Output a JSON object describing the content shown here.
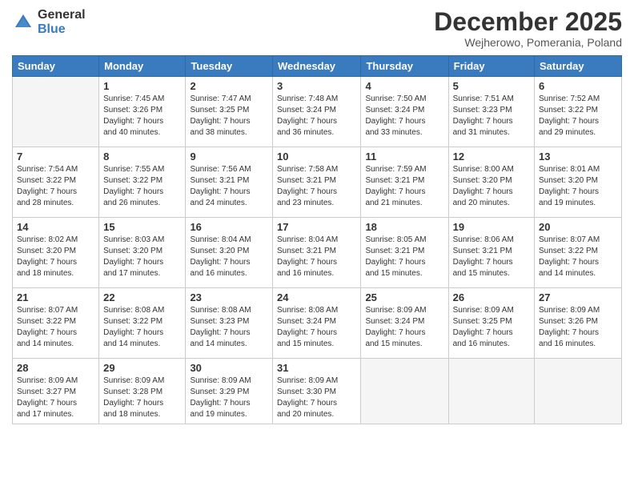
{
  "logo": {
    "general": "General",
    "blue": "Blue"
  },
  "title": "December 2025",
  "location": "Wejherowo, Pomerania, Poland",
  "days_of_week": [
    "Sunday",
    "Monday",
    "Tuesday",
    "Wednesday",
    "Thursday",
    "Friday",
    "Saturday"
  ],
  "weeks": [
    [
      {
        "day": "",
        "info": ""
      },
      {
        "day": "1",
        "info": "Sunrise: 7:45 AM\nSunset: 3:26 PM\nDaylight: 7 hours\nand 40 minutes."
      },
      {
        "day": "2",
        "info": "Sunrise: 7:47 AM\nSunset: 3:25 PM\nDaylight: 7 hours\nand 38 minutes."
      },
      {
        "day": "3",
        "info": "Sunrise: 7:48 AM\nSunset: 3:24 PM\nDaylight: 7 hours\nand 36 minutes."
      },
      {
        "day": "4",
        "info": "Sunrise: 7:50 AM\nSunset: 3:24 PM\nDaylight: 7 hours\nand 33 minutes."
      },
      {
        "day": "5",
        "info": "Sunrise: 7:51 AM\nSunset: 3:23 PM\nDaylight: 7 hours\nand 31 minutes."
      },
      {
        "day": "6",
        "info": "Sunrise: 7:52 AM\nSunset: 3:22 PM\nDaylight: 7 hours\nand 29 minutes."
      }
    ],
    [
      {
        "day": "7",
        "info": "Sunrise: 7:54 AM\nSunset: 3:22 PM\nDaylight: 7 hours\nand 28 minutes."
      },
      {
        "day": "8",
        "info": "Sunrise: 7:55 AM\nSunset: 3:22 PM\nDaylight: 7 hours\nand 26 minutes."
      },
      {
        "day": "9",
        "info": "Sunrise: 7:56 AM\nSunset: 3:21 PM\nDaylight: 7 hours\nand 24 minutes."
      },
      {
        "day": "10",
        "info": "Sunrise: 7:58 AM\nSunset: 3:21 PM\nDaylight: 7 hours\nand 23 minutes."
      },
      {
        "day": "11",
        "info": "Sunrise: 7:59 AM\nSunset: 3:21 PM\nDaylight: 7 hours\nand 21 minutes."
      },
      {
        "day": "12",
        "info": "Sunrise: 8:00 AM\nSunset: 3:20 PM\nDaylight: 7 hours\nand 20 minutes."
      },
      {
        "day": "13",
        "info": "Sunrise: 8:01 AM\nSunset: 3:20 PM\nDaylight: 7 hours\nand 19 minutes."
      }
    ],
    [
      {
        "day": "14",
        "info": "Sunrise: 8:02 AM\nSunset: 3:20 PM\nDaylight: 7 hours\nand 18 minutes."
      },
      {
        "day": "15",
        "info": "Sunrise: 8:03 AM\nSunset: 3:20 PM\nDaylight: 7 hours\nand 17 minutes."
      },
      {
        "day": "16",
        "info": "Sunrise: 8:04 AM\nSunset: 3:20 PM\nDaylight: 7 hours\nand 16 minutes."
      },
      {
        "day": "17",
        "info": "Sunrise: 8:04 AM\nSunset: 3:21 PM\nDaylight: 7 hours\nand 16 minutes."
      },
      {
        "day": "18",
        "info": "Sunrise: 8:05 AM\nSunset: 3:21 PM\nDaylight: 7 hours\nand 15 minutes."
      },
      {
        "day": "19",
        "info": "Sunrise: 8:06 AM\nSunset: 3:21 PM\nDaylight: 7 hours\nand 15 minutes."
      },
      {
        "day": "20",
        "info": "Sunrise: 8:07 AM\nSunset: 3:22 PM\nDaylight: 7 hours\nand 14 minutes."
      }
    ],
    [
      {
        "day": "21",
        "info": "Sunrise: 8:07 AM\nSunset: 3:22 PM\nDaylight: 7 hours\nand 14 minutes."
      },
      {
        "day": "22",
        "info": "Sunrise: 8:08 AM\nSunset: 3:22 PM\nDaylight: 7 hours\nand 14 minutes."
      },
      {
        "day": "23",
        "info": "Sunrise: 8:08 AM\nSunset: 3:23 PM\nDaylight: 7 hours\nand 14 minutes."
      },
      {
        "day": "24",
        "info": "Sunrise: 8:08 AM\nSunset: 3:24 PM\nDaylight: 7 hours\nand 15 minutes."
      },
      {
        "day": "25",
        "info": "Sunrise: 8:09 AM\nSunset: 3:24 PM\nDaylight: 7 hours\nand 15 minutes."
      },
      {
        "day": "26",
        "info": "Sunrise: 8:09 AM\nSunset: 3:25 PM\nDaylight: 7 hours\nand 16 minutes."
      },
      {
        "day": "27",
        "info": "Sunrise: 8:09 AM\nSunset: 3:26 PM\nDaylight: 7 hours\nand 16 minutes."
      }
    ],
    [
      {
        "day": "28",
        "info": "Sunrise: 8:09 AM\nSunset: 3:27 PM\nDaylight: 7 hours\nand 17 minutes."
      },
      {
        "day": "29",
        "info": "Sunrise: 8:09 AM\nSunset: 3:28 PM\nDaylight: 7 hours\nand 18 minutes."
      },
      {
        "day": "30",
        "info": "Sunrise: 8:09 AM\nSunset: 3:29 PM\nDaylight: 7 hours\nand 19 minutes."
      },
      {
        "day": "31",
        "info": "Sunrise: 8:09 AM\nSunset: 3:30 PM\nDaylight: 7 hours\nand 20 minutes."
      },
      {
        "day": "",
        "info": ""
      },
      {
        "day": "",
        "info": ""
      },
      {
        "day": "",
        "info": ""
      }
    ]
  ]
}
